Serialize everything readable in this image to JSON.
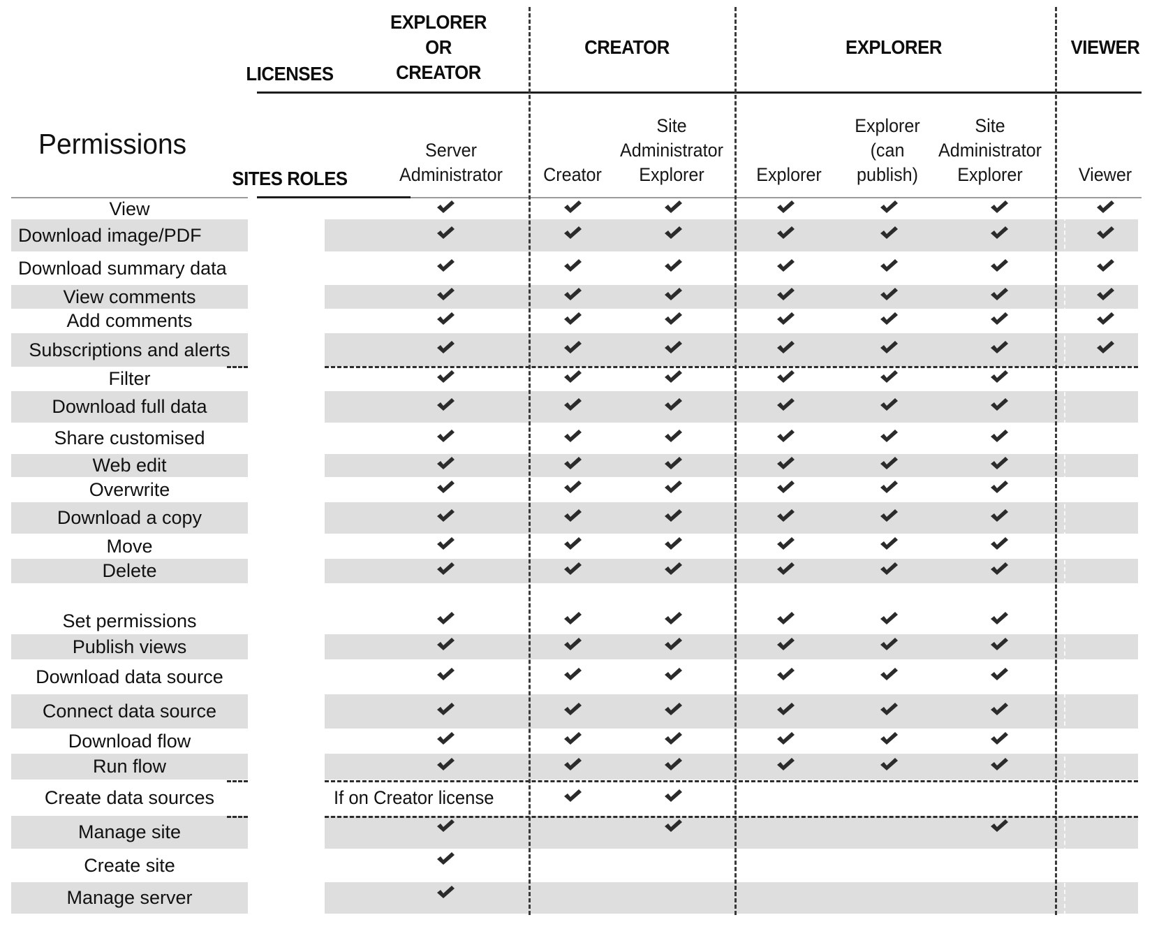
{
  "title": "Permissions",
  "header": {
    "licenses_label": "LICENSES",
    "sites_roles_label": "SITES ROLES",
    "licenses": [
      {
        "label_lines": [
          "EXPLORER",
          "OR",
          "CREATOR"
        ]
      },
      {
        "label_lines": [
          "CREATOR"
        ]
      },
      {
        "label_lines": [
          "EXPLORER"
        ]
      },
      {
        "label_lines": [
          "VIEWER"
        ]
      }
    ],
    "roles": [
      {
        "label_lines": [
          "Server",
          "Administrator"
        ]
      },
      {
        "label_lines": [
          "Creator"
        ]
      },
      {
        "label_lines": [
          "Site",
          "Administrator",
          "Explorer"
        ]
      },
      {
        "label_lines": [
          "Explorer"
        ]
      },
      {
        "label_lines": [
          "Explorer",
          "(can",
          "publish)"
        ]
      },
      {
        "label_lines": [
          "Site",
          "Administrator",
          "Explorer"
        ]
      },
      {
        "label_lines": [
          "Viewer"
        ]
      }
    ]
  },
  "check_icon": "heavy-check-mark",
  "colors": {
    "band": "#dedede",
    "check": "#2b2b2b",
    "divider": "#3a3a3a"
  },
  "rows": [
    {
      "label": "View",
      "checks": [
        true,
        true,
        true,
        true,
        true,
        true,
        true
      ]
    },
    {
      "label": "Download image/PDF",
      "checks": [
        true,
        true,
        true,
        true,
        true,
        true,
        true
      ]
    },
    {
      "label": "Download summary data",
      "checks": [
        true,
        true,
        true,
        true,
        true,
        true,
        true
      ]
    },
    {
      "label": "View comments",
      "checks": [
        true,
        true,
        true,
        true,
        true,
        true,
        true
      ]
    },
    {
      "label": "Add comments",
      "checks": [
        true,
        true,
        true,
        true,
        true,
        true,
        true
      ]
    },
    {
      "label": "Subscriptions and alerts",
      "checks": [
        true,
        true,
        true,
        true,
        true,
        true,
        true
      ]
    },
    {
      "label": "Filter",
      "checks": [
        true,
        true,
        true,
        true,
        true,
        true,
        false
      ]
    },
    {
      "label": "Download full data",
      "checks": [
        true,
        true,
        true,
        true,
        true,
        true,
        false
      ]
    },
    {
      "label": "Share customised",
      "checks": [
        true,
        true,
        true,
        true,
        true,
        true,
        false
      ]
    },
    {
      "label": "Web edit",
      "checks": [
        true,
        true,
        true,
        true,
        true,
        true,
        false
      ]
    },
    {
      "label": "Overwrite",
      "checks": [
        true,
        true,
        true,
        true,
        true,
        true,
        false
      ]
    },
    {
      "label": "Download a copy",
      "checks": [
        true,
        true,
        true,
        true,
        true,
        true,
        false
      ]
    },
    {
      "label": "Move",
      "checks": [
        true,
        true,
        true,
        true,
        true,
        true,
        false
      ]
    },
    {
      "label": "Delete",
      "checks": [
        true,
        true,
        true,
        true,
        true,
        true,
        false
      ]
    },
    {
      "label": "Set permissions",
      "checks": [
        true,
        true,
        true,
        true,
        true,
        true,
        false
      ]
    },
    {
      "label": "Publish views",
      "checks": [
        true,
        true,
        true,
        true,
        true,
        true,
        false
      ]
    },
    {
      "label": "Download data source",
      "checks": [
        true,
        true,
        true,
        true,
        true,
        true,
        false
      ]
    },
    {
      "label": "Connect data source",
      "checks": [
        true,
        true,
        true,
        true,
        true,
        true,
        false
      ]
    },
    {
      "label": "Download flow",
      "checks": [
        true,
        true,
        true,
        true,
        true,
        true,
        false
      ]
    },
    {
      "label": "Run flow",
      "checks": [
        true,
        true,
        true,
        true,
        true,
        true,
        false
      ]
    },
    {
      "label": "Create data sources",
      "checks": [
        false,
        true,
        true,
        false,
        false,
        false,
        false
      ],
      "note": "If on Creator license"
    },
    {
      "label": "Manage site",
      "checks": [
        true,
        false,
        true,
        false,
        false,
        true,
        false
      ]
    },
    {
      "label": "Create site",
      "checks": [
        true,
        false,
        false,
        false,
        false,
        false,
        false
      ]
    },
    {
      "label": "Manage server",
      "checks": [
        true,
        false,
        false,
        false,
        false,
        false,
        false
      ]
    }
  ]
}
